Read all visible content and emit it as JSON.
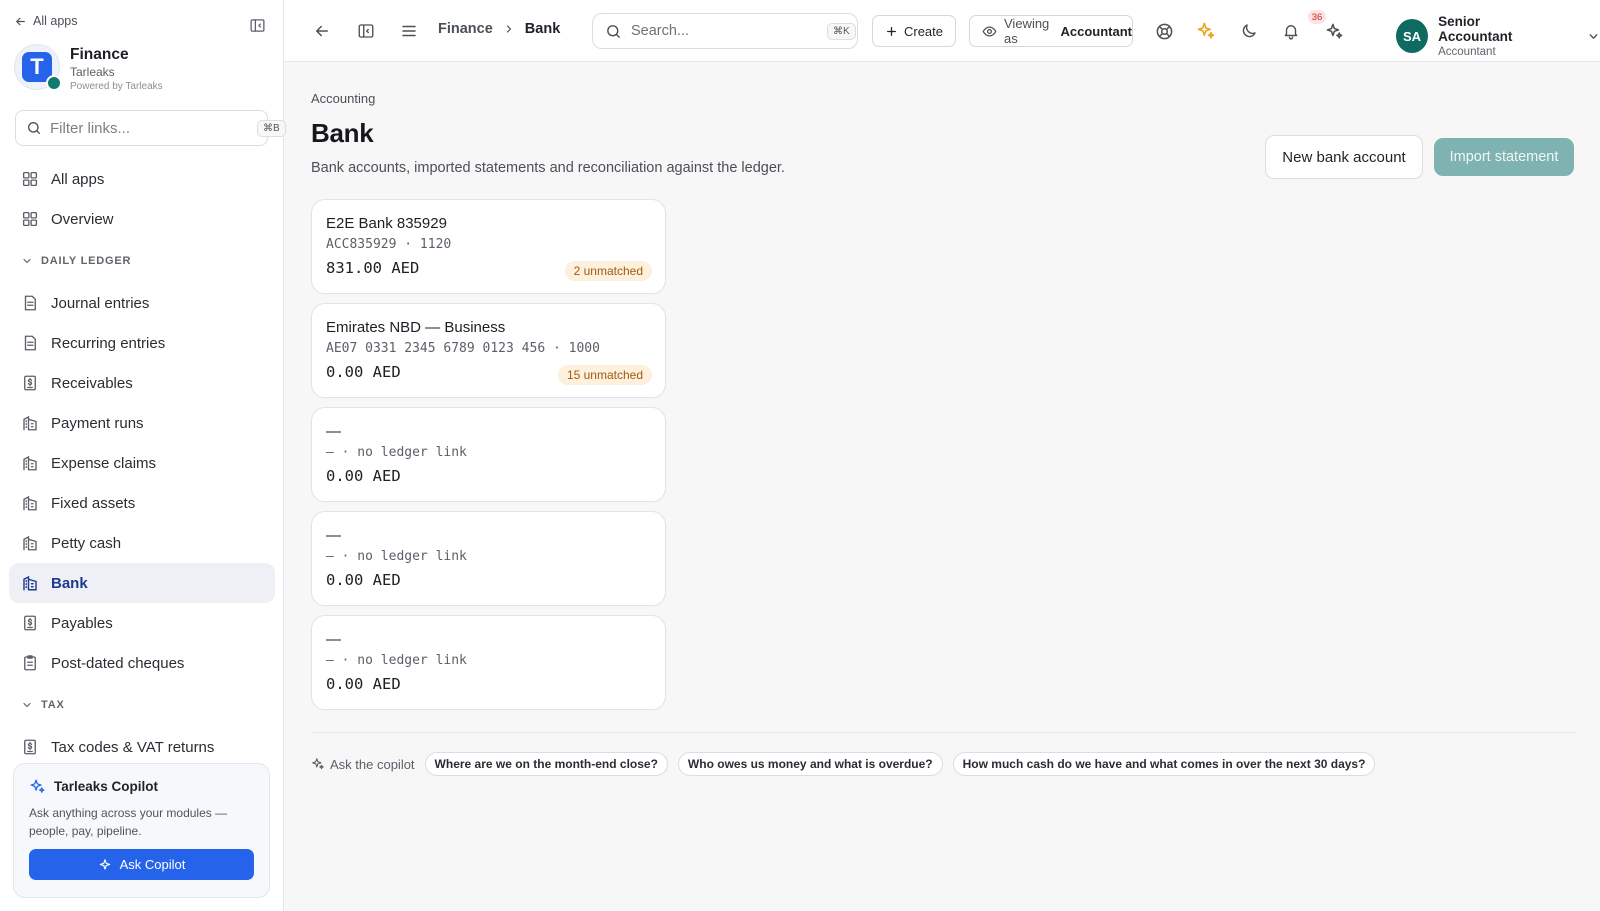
{
  "sidebar": {
    "back_label": "All apps",
    "org": {
      "name": "Finance",
      "company": "Tarleaks",
      "powered": "Powered by Tarleaks",
      "logo_letter": "T"
    },
    "filter": {
      "placeholder": "Filter links...",
      "shortcut": "⌘B"
    },
    "top_items": [
      {
        "label": "All apps",
        "icon": "grid-icon"
      },
      {
        "label": "Overview",
        "icon": "grid-icon"
      }
    ],
    "sections": [
      {
        "label": "DAILY LEDGER",
        "items": [
          {
            "label": "Journal entries",
            "icon": "document-icon"
          },
          {
            "label": "Recurring entries",
            "icon": "document-icon"
          },
          {
            "label": "Receivables",
            "icon": "dollar-doc-icon"
          },
          {
            "label": "Payment runs",
            "icon": "building-icon"
          },
          {
            "label": "Expense claims",
            "icon": "building-icon"
          },
          {
            "label": "Fixed assets",
            "icon": "building-icon"
          },
          {
            "label": "Petty cash",
            "icon": "building-icon"
          },
          {
            "label": "Bank",
            "icon": "building-icon",
            "active": true
          },
          {
            "label": "Payables",
            "icon": "dollar-doc-icon"
          },
          {
            "label": "Post-dated cheques",
            "icon": "clipboard-icon"
          }
        ]
      },
      {
        "label": "TAX",
        "items": [
          {
            "label": "Tax codes & VAT returns",
            "icon": "dollar-doc-icon"
          }
        ]
      }
    ],
    "copilot": {
      "title": "Tarleaks Copilot",
      "description": "Ask anything across your modules — people, pay, pipeline.",
      "button": "Ask Copilot"
    }
  },
  "topbar": {
    "breadcrumb": [
      "Finance",
      "Bank"
    ],
    "search": {
      "placeholder": "Search...",
      "shortcut": "⌘K"
    },
    "create_label": "Create",
    "viewing_prefix": "Viewing as",
    "viewing_role": "Accountant",
    "notification_count": "36",
    "user": {
      "initials": "SA",
      "name": "Senior Accountant",
      "role": "Accountant"
    }
  },
  "page": {
    "eyebrow": "Accounting",
    "title": "Bank",
    "description": "Bank accounts, imported statements and reconciliation against the ledger.",
    "new_account_label": "New bank account",
    "import_label": "Import statement"
  },
  "accounts": [
    {
      "name": "E2E Bank 835929",
      "meta": "ACC835929 · 1120",
      "balance": "831.00 AED",
      "badge": "2 unmatched"
    },
    {
      "name": "Emirates NBD — Business",
      "meta": "AE07 0331 2345 6789 0123 456 · 1000",
      "balance": "0.00 AED",
      "badge": "15 unmatched"
    },
    {
      "name": "—",
      "meta": "— · no ledger link",
      "balance": "0.00 AED",
      "badge": ""
    },
    {
      "name": "—",
      "meta": "— · no ledger link",
      "balance": "0.00 AED",
      "badge": ""
    },
    {
      "name": "—",
      "meta": "— · no ledger link",
      "balance": "0.00 AED",
      "badge": ""
    }
  ],
  "copilot_suggestions": {
    "label": "Ask the copilot",
    "chips": [
      "Where are we on the month-end close?",
      "Who owes us money and what is overdue?",
      "How much cash do we have and what comes in over the next 30 days?"
    ]
  },
  "colors": {
    "accent": "#2563eb",
    "primary_disabled": "#7fb3b1",
    "badge_bg": "#fdf0dc",
    "badge_text": "#a05a12",
    "avatar": "#0f6b62"
  }
}
